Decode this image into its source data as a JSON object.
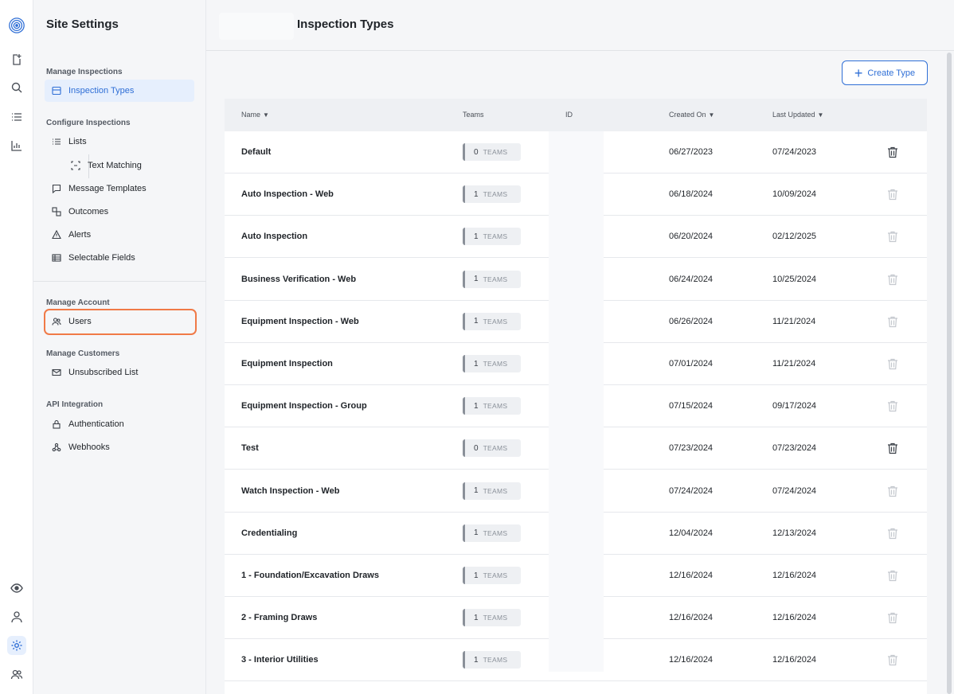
{
  "app": {
    "logo": "target-logo"
  },
  "rail": {
    "icons": [
      "add-document-icon",
      "search-icon",
      "list-icon",
      "chart-icon",
      "eye-icon",
      "user-icon",
      "gear-icon",
      "team-icon"
    ],
    "active": "gear-icon"
  },
  "sidebar": {
    "title": "Site Settings",
    "sections": {
      "manage_inspections": "Manage Inspections",
      "configure_inspections": "Configure Inspections",
      "manage_account": "Manage Account",
      "manage_customers": "Manage Customers",
      "api_integration": "API Integration"
    },
    "items": {
      "inspection_types": "Inspection Types",
      "lists": "Lists",
      "text_matching": "Text Matching",
      "message_templates": "Message Templates",
      "outcomes": "Outcomes",
      "alerts": "Alerts",
      "selectable_fields": "Selectable Fields",
      "users": "Users",
      "unsubscribed_list": "Unsubscribed List",
      "authentication": "Authentication",
      "webhooks": "Webhooks"
    },
    "highlight_color": "#f07a47",
    "accent_color": "#2f6fd6"
  },
  "header": {
    "title": "Inspection Types"
  },
  "toolbar": {
    "create_label": "Create Type"
  },
  "table": {
    "columns": {
      "name": "Name",
      "teams": "Teams",
      "id": "ID",
      "created": "Created On",
      "updated": "Last Updated"
    },
    "teams_suffix": "TEAMS",
    "rows": [
      {
        "name": "Default",
        "teams": "0",
        "created": "06/27/2023",
        "updated": "07/24/2023",
        "delete_enabled": true
      },
      {
        "name": "Auto Inspection - Web",
        "teams": "1",
        "created": "06/18/2024",
        "updated": "10/09/2024",
        "delete_enabled": false
      },
      {
        "name": "Auto Inspection",
        "teams": "1",
        "created": "06/20/2024",
        "updated": "02/12/2025",
        "delete_enabled": false
      },
      {
        "name": "Business Verification - Web",
        "teams": "1",
        "created": "06/24/2024",
        "updated": "10/25/2024",
        "delete_enabled": false
      },
      {
        "name": "Equipment Inspection - Web",
        "teams": "1",
        "created": "06/26/2024",
        "updated": "11/21/2024",
        "delete_enabled": false
      },
      {
        "name": "Equipment Inspection",
        "teams": "1",
        "created": "07/01/2024",
        "updated": "11/21/2024",
        "delete_enabled": false
      },
      {
        "name": "Equipment Inspection - Group",
        "teams": "1",
        "created": "07/15/2024",
        "updated": "09/17/2024",
        "delete_enabled": false
      },
      {
        "name": "Test",
        "teams": "0",
        "created": "07/23/2024",
        "updated": "07/23/2024",
        "delete_enabled": true
      },
      {
        "name": "Watch Inspection - Web",
        "teams": "1",
        "created": "07/24/2024",
        "updated": "07/24/2024",
        "delete_enabled": false
      },
      {
        "name": "Credentialing",
        "teams": "1",
        "created": "12/04/2024",
        "updated": "12/13/2024",
        "delete_enabled": false
      },
      {
        "name": "1 - Foundation/Excavation Draws",
        "teams": "1",
        "created": "12/16/2024",
        "updated": "12/16/2024",
        "delete_enabled": false
      },
      {
        "name": "2 - Framing Draws",
        "teams": "1",
        "created": "12/16/2024",
        "updated": "12/16/2024",
        "delete_enabled": false
      },
      {
        "name": "3 - Interior Utilities",
        "teams": "1",
        "created": "12/16/2024",
        "updated": "12/16/2024",
        "delete_enabled": false
      }
    ]
  }
}
